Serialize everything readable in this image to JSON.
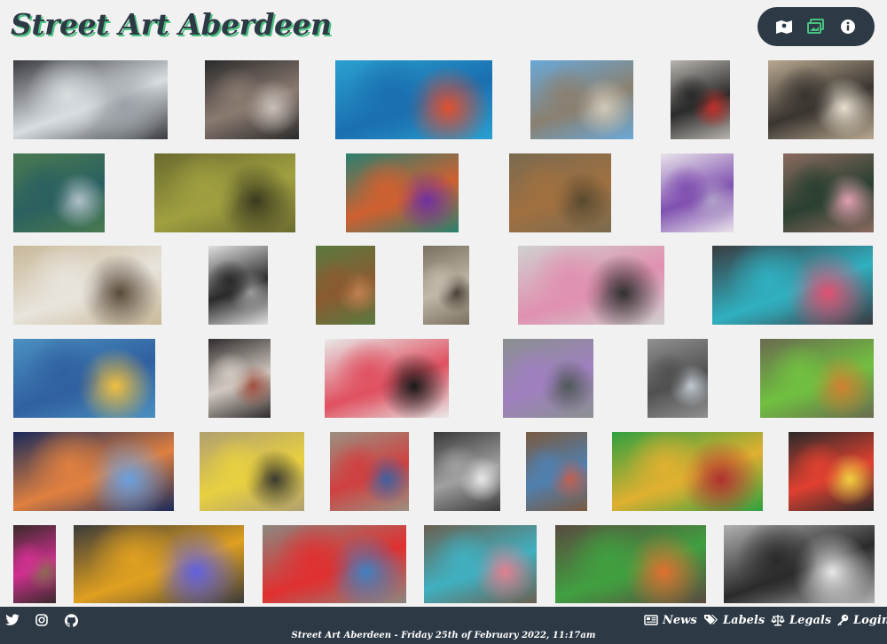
{
  "site": {
    "title": "Street Art Aberdeen"
  },
  "toolbar": {
    "buttons": [
      "map-icon",
      "gallery-icon",
      "info-icon"
    ]
  },
  "gallery": {
    "tiles": [
      [
        "#3a3c40",
        "#d8dde0",
        "#9aa0a6"
      ],
      [
        "#2b2b2b",
        "#8a7a70",
        "#c8c0b8"
      ],
      [
        "#2aa0d0",
        "#1a6fb0",
        "#e05030"
      ],
      [
        "#6aa8d8",
        "#8a8070",
        "#d0c8b8"
      ],
      [
        "#b8b4ae",
        "#2a2a2a",
        "#c0302a"
      ],
      [
        "#b8a890",
        "#3a3530",
        "#e8e0d0"
      ],
      [
        "#4a7a50",
        "#2a6060",
        "#b0c0c8"
      ],
      [
        "#6a6a30",
        "#a0a040",
        "#3a3a20"
      ],
      [
        "#2a8070",
        "#d06030",
        "#7030a0"
      ],
      [
        "#7a6a50",
        "#a07040",
        "#5a4a30"
      ],
      [
        "#e8e4ea",
        "#8050b0",
        "#b0a0c8"
      ],
      [
        "#8a6a60",
        "#2a4030",
        "#e0a0b0"
      ],
      [
        "#c8b898",
        "#e8e4dc",
        "#5a4a3a"
      ],
      [
        "#e0e0e0",
        "#2a2a2a",
        "#9a9a9a"
      ],
      [
        "#5a7a40",
        "#8a5a30",
        "#c08050"
      ],
      [
        "#7a7060",
        "#c0b8a8",
        "#4a4238"
      ],
      [
        "#d0d0d0",
        "#e090b0",
        "#303030"
      ],
      [
        "#3a3a40",
        "#30b0c0",
        "#e05070"
      ],
      [
        "#4a90c0",
        "#3060a0",
        "#f0c040"
      ],
      [
        "#302c2c",
        "#d0c8c0",
        "#a05040"
      ],
      [
        "#e8e8e8",
        "#e05060",
        "#1a1a1a"
      ],
      [
        "#8a9090",
        "#a080c0",
        "#505858"
      ],
      [
        "#909090",
        "#505050",
        "#c0c8d0"
      ],
      [
        "#6a6a50",
        "#70c040",
        "#d08030"
      ],
      [
        "#1a2a5a",
        "#e08040",
        "#6aa0e0"
      ],
      [
        "#b0a070",
        "#e8d040",
        "#3a3a30"
      ],
      [
        "#9a9080",
        "#d04040",
        "#4060a0"
      ],
      [
        "#3a3a3a",
        "#a0a0a0",
        "#e8e8e8"
      ],
      [
        "#7a5a40",
        "#5080b0",
        "#c06050"
      ],
      [
        "#30a040",
        "#e0b030",
        "#b03030"
      ],
      [
        "#2a2a2a",
        "#e04030",
        "#f0d040"
      ],
      [
        "#3a2a2a",
        "#d03090",
        "#8a6a50"
      ],
      [
        "#3a3a3a",
        "#e0a020",
        "#6060e0"
      ],
      [
        "#8a8880",
        "#e03030",
        "#4080c0"
      ],
      [
        "#6a6050",
        "#40b0c0",
        "#e08090"
      ],
      [
        "#5a4a40",
        "#40a040",
        "#e07030"
      ],
      [
        "#b0b0b0",
        "#2a2a2a",
        "#e8e8e8"
      ]
    ]
  },
  "footer": {
    "social": [
      "twitter-icon",
      "instagram-icon",
      "github-icon"
    ],
    "links": {
      "news": "News",
      "labels": "Labels",
      "legals": "Legals",
      "login": "Login"
    },
    "dateline": "Street Art Aberdeen - Friday 25th of February 2022, 11:17am"
  },
  "colors": {
    "dark": "#2d3945",
    "accent": "#49c27f",
    "background": "#f1f1f1"
  }
}
